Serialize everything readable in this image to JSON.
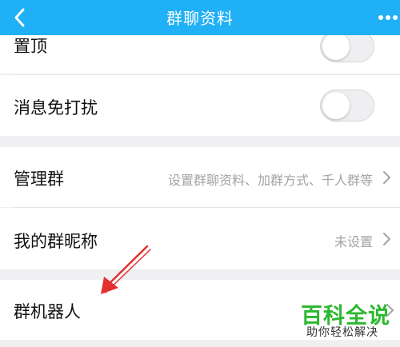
{
  "header": {
    "title": "群聊资料",
    "bg_color": "#1fb0f5"
  },
  "rows": {
    "pin_label": "置顶",
    "mute_label": "消息免打扰",
    "manage_label": "管理群",
    "manage_hint": "设置群聊资料、加群方式、千人群等",
    "nickname_label": "我的群昵称",
    "nickname_value": "未设置",
    "robot_label": "群机器人"
  },
  "toggles": {
    "pin": false,
    "mute": false
  },
  "watermark": {
    "title": "百科全说",
    "subtitle": "助你轻松解决"
  },
  "annotation_color": "#e53030"
}
